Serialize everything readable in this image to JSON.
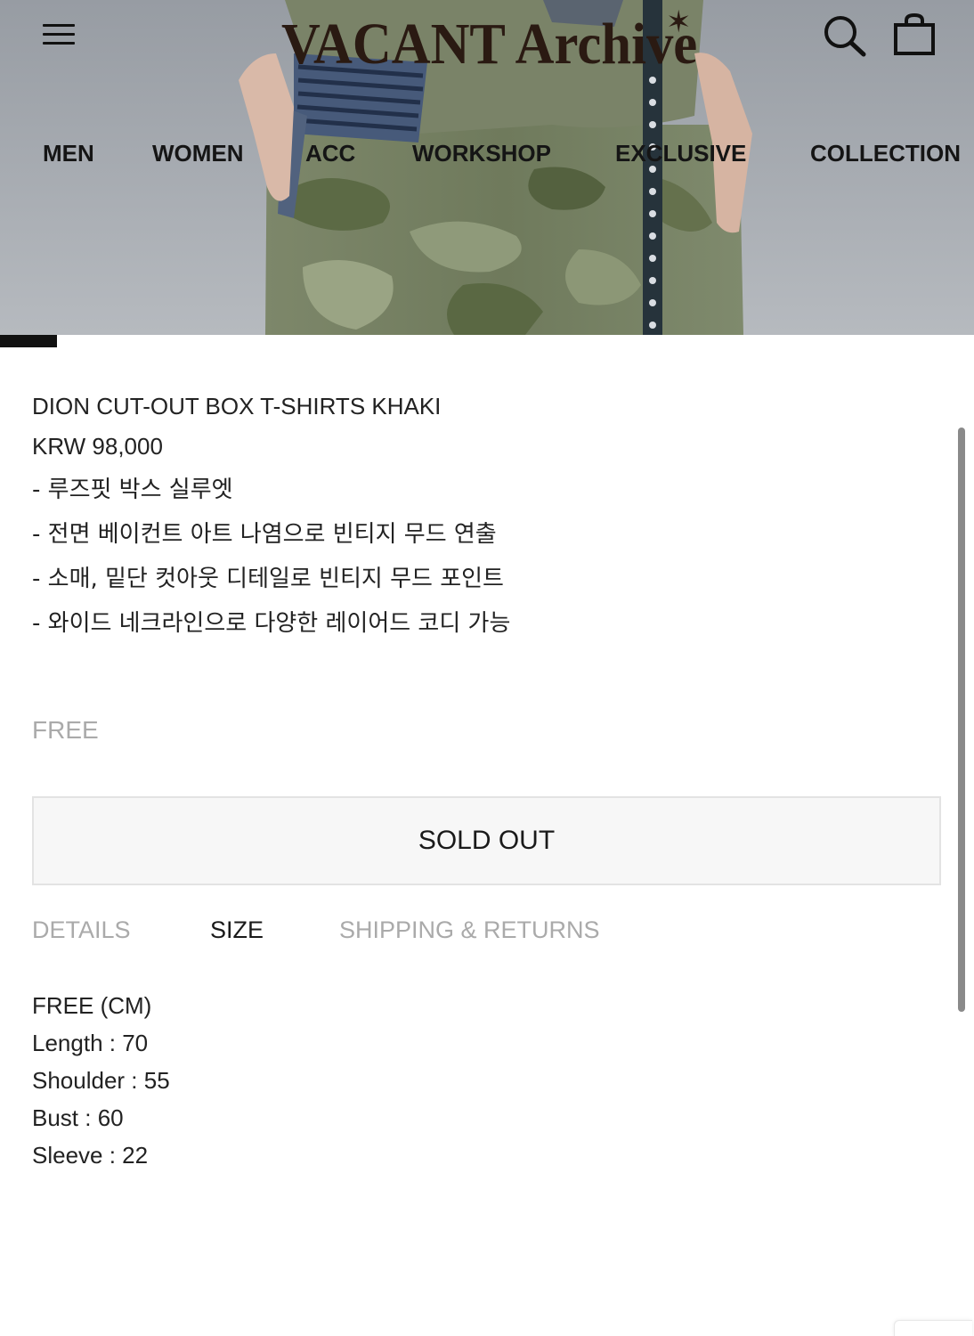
{
  "header": {
    "logo_text": "VACANT Archive",
    "logo_star": "✶",
    "menu_icon": "hamburger-menu-icon",
    "search_icon": "search-icon",
    "cart_icon": "shopping-bag-icon"
  },
  "nav": {
    "items": [
      {
        "label": "MEN"
      },
      {
        "label": "WOMEN"
      },
      {
        "label": "ACC"
      },
      {
        "label": "WORKSHOP"
      },
      {
        "label": "EXCLUSIVE"
      },
      {
        "label": "COLLECTION"
      }
    ]
  },
  "product": {
    "name": "DION CUT-OUT BOX T-SHIRTS KHAKI",
    "price": "KRW 98,000",
    "description": [
      "- 루즈핏 박스 실루엣",
      "- 전면 베이컨트 아트 나염으로 빈티지 무드 연출",
      "- 소매, 밑단 컷아웃 디테일로 빈티지 무드 포인트",
      "- 와이드 네크라인으로 다양한 레이어드 코디 가능"
    ],
    "size_option": "FREE",
    "sold_out_label": "SOLD OUT"
  },
  "tabs": {
    "items": [
      {
        "label": "DETAILS",
        "active": false
      },
      {
        "label": "SIZE",
        "active": true
      },
      {
        "label": "SHIPPING & RETURNS",
        "active": false
      }
    ]
  },
  "size_info": {
    "lines": [
      "FREE (CM)",
      "Length : 70",
      "Shoulder : 55",
      "Bust : 60",
      "Sleeve : 22"
    ]
  },
  "colors": {
    "text": "#222222",
    "muted": "#aaaaaa",
    "logo": "#2a1a12",
    "button_bg": "#f7f7f7",
    "button_border": "#e3e3e3"
  }
}
